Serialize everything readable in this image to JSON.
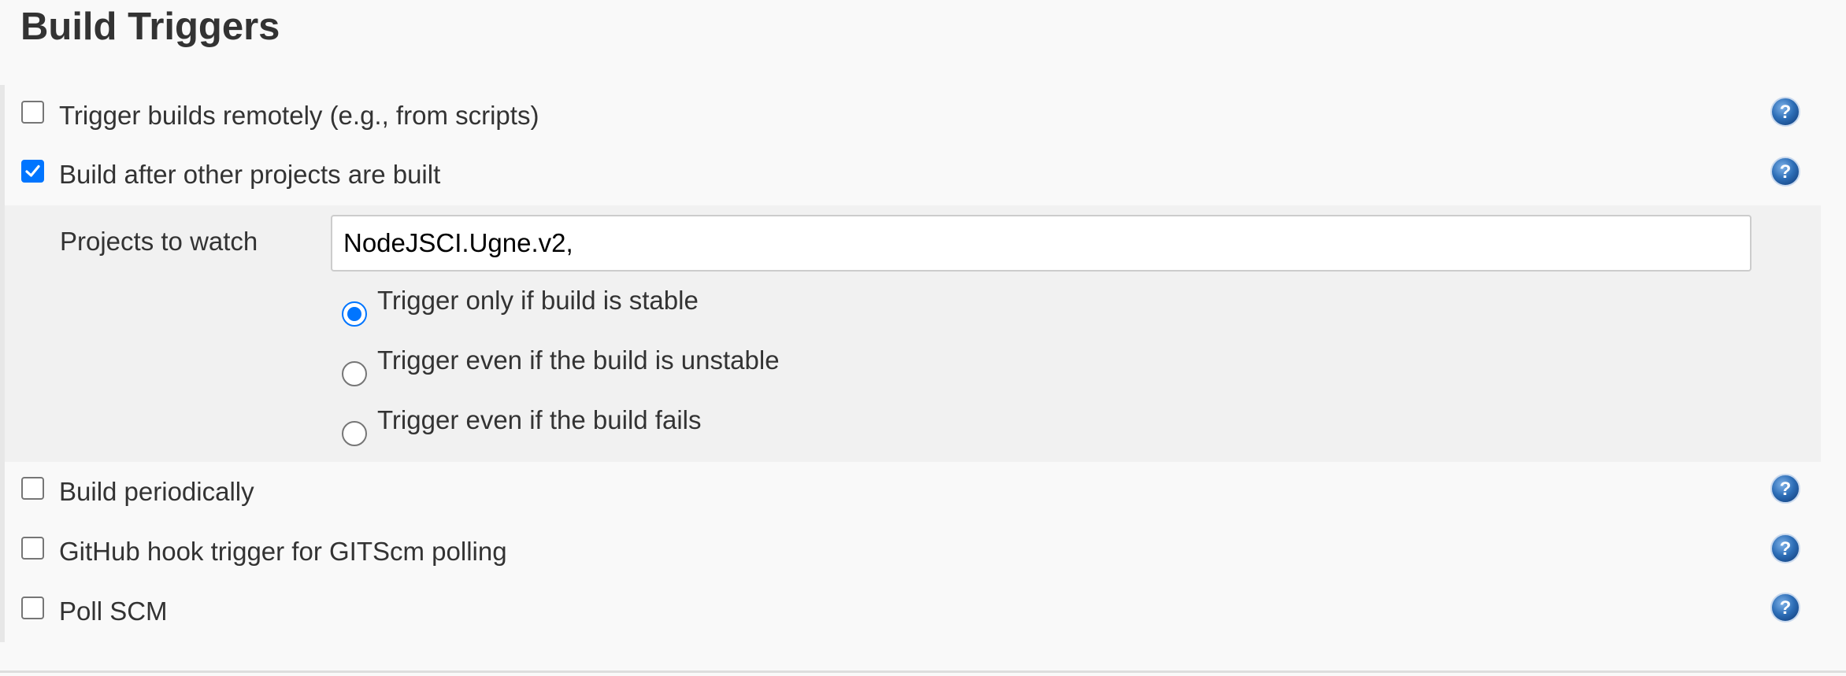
{
  "section": {
    "title": "Build Triggers"
  },
  "triggers": [
    {
      "label": "Trigger builds remotely (e.g., from scripts)",
      "checked": false,
      "icon": "help-icon"
    },
    {
      "label": "Build after other projects are built",
      "checked": true,
      "icon": "help-icon"
    },
    {
      "label": "Build periodically",
      "checked": false,
      "icon": "help-icon"
    },
    {
      "label": "GitHub hook trigger for GITScm polling",
      "checked": false,
      "icon": "help-icon"
    },
    {
      "label": "Poll SCM",
      "checked": false,
      "icon": "help-icon"
    }
  ],
  "build_after": {
    "projects_label": "Projects to watch",
    "projects_value": "NodeJSCI.Ugne.v2,",
    "options": [
      {
        "label": "Trigger only if build is stable",
        "selected": true
      },
      {
        "label": "Trigger even if the build is unstable",
        "selected": false
      },
      {
        "label": "Trigger even if the build fails",
        "selected": false
      }
    ]
  },
  "colors": {
    "accent": "#0075ff",
    "help_icon": "#1f5fa8",
    "nested_background": "#f1f1f1",
    "page_background": "#f9f9f9"
  }
}
